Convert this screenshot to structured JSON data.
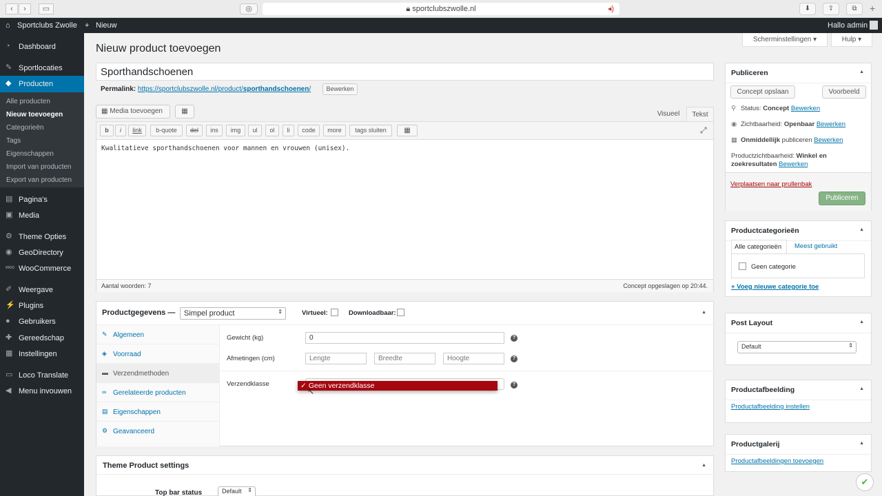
{
  "browser": {
    "url": "sportclubszwolle.nl"
  },
  "adminbar": {
    "site_name": "Sportclubs Zwolle",
    "new_label": "Nieuw",
    "greeting": "Hallo admin"
  },
  "sidebar": {
    "items": [
      {
        "label": "Dashboard",
        "icon": "dashboard-icon"
      },
      {
        "label": "Sportlocaties",
        "icon": "pin-icon"
      },
      {
        "label": "Producten",
        "icon": "box-icon"
      },
      {
        "label": "Pagina's",
        "icon": "page-icon"
      },
      {
        "label": "Media",
        "icon": "media-icon"
      },
      {
        "label": "Theme Opties",
        "icon": "gear-icon"
      },
      {
        "label": "GeoDirectory",
        "icon": "globe-icon"
      },
      {
        "label": "WooCommerce",
        "icon": "woo-icon"
      },
      {
        "label": "Weergave",
        "icon": "brush-icon"
      },
      {
        "label": "Plugins",
        "icon": "plug-icon"
      },
      {
        "label": "Gebruikers",
        "icon": "user-icon"
      },
      {
        "label": "Gereedschap",
        "icon": "wrench-icon"
      },
      {
        "label": "Instellingen",
        "icon": "settings-icon"
      },
      {
        "label": "Loco Translate",
        "icon": "translate-icon"
      },
      {
        "label": "Menu invouwen",
        "icon": "collapse-icon"
      }
    ],
    "submenu": [
      "Alle producten",
      "Nieuw toevoegen",
      "Categorieën",
      "Tags",
      "Eigenschappen",
      "Import van producten",
      "Export van producten"
    ]
  },
  "main": {
    "title": "Nieuw product toevoegen",
    "screen_options": "Scherminstellingen",
    "help": "Hulp",
    "product_title": "Sporthandschoenen",
    "permalink_label": "Permalink:",
    "permalink_base": "https://sportclubszwolle.nl/product/",
    "permalink_slug": "sporthandschoenen",
    "permalink_end": "/",
    "edit_label": "Bewerken",
    "add_media": "Media toevoegen",
    "tab_visual": "Visueel",
    "tab_text": "Tekst",
    "quicktags": [
      "b",
      "i",
      "link",
      "b-quote",
      "del",
      "ins",
      "img",
      "ul",
      "ol",
      "li",
      "code",
      "more",
      "tags sluiten"
    ],
    "content": "Kwalitatieve sporthandschoenen voor mannen en vrouwen (unisex).",
    "word_count": "Aantal woorden: 7",
    "draft_saved": "Concept opgeslagen op 20:44."
  },
  "product_data": {
    "title": "Productgegevens —",
    "type": "Simpel product",
    "virtual_label": "Virtueel:",
    "downloadable_label": "Downloadbaar:",
    "tabs": [
      {
        "label": "Algemeen",
        "icon": "wrench-icon"
      },
      {
        "label": "Voorraad",
        "icon": "tag-icon"
      },
      {
        "label": "Verzendmethoden",
        "icon": "truck-icon"
      },
      {
        "label": "Gerelateerde producten",
        "icon": "link-icon"
      },
      {
        "label": "Eigenschappen",
        "icon": "list-icon"
      },
      {
        "label": "Geavanceerd",
        "icon": "gear-icon"
      }
    ],
    "weight_label": "Gewicht (kg)",
    "weight_value": "0",
    "dimensions_label": "Afmetingen (cm)",
    "length_ph": "Lengte",
    "width_ph": "Breedte",
    "height_ph": "Hoogte",
    "shipping_class_label": "Verzendklasse",
    "shipping_class_value": "Geen verzendklasse"
  },
  "theme_settings": {
    "title": "Theme Product settings",
    "top_bar_label": "Top bar status",
    "top_bar_value": "Default"
  },
  "publish": {
    "title": "Publiceren",
    "save_draft": "Concept opslaan",
    "preview": "Voorbeeld",
    "status_label": "Status:",
    "status_value": "Concept",
    "visibility_label": "Zichtbaarheid:",
    "visibility_value": "Openbaar",
    "publish_label": "Onmiddellijk",
    "publish_rest": "publiceren",
    "catalog_label": "Productzichtbaarheid:",
    "catalog_value_1": "Winkel en",
    "catalog_value_2": "zoekresultaten",
    "edit_label": "Bewerken",
    "trash": "Verplaatsen naar prullenbak",
    "publish_button": "Publiceren"
  },
  "categories": {
    "title": "Productcategorieën",
    "tab_all": "Alle categorieën",
    "tab_popular": "Meest gebruikt",
    "item": "Geen categorie",
    "add_new": "+ Voeg nieuwe categorie toe"
  },
  "post_layout": {
    "title": "Post Layout",
    "value": "Default"
  },
  "product_image": {
    "title": "Productafbeelding",
    "link": "Productafbeelding instellen"
  },
  "gallery": {
    "title": "Productgalerij",
    "link": "Productafbeeldingen toevoegen"
  },
  "colors": {
    "admin_dark": "#23282d",
    "accent": "#0073aa",
    "trash": "#a00",
    "publish": "#86b486",
    "dropdown_highlight": "#a6070f"
  }
}
